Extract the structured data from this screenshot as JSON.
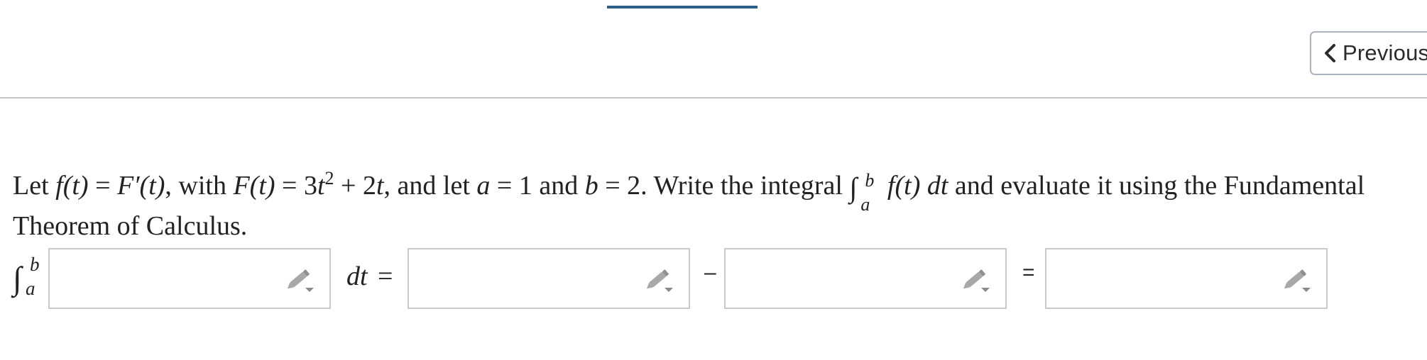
{
  "top_indicator": {
    "color": "#2e5f86"
  },
  "navigation": {
    "previous_label": "Previous",
    "previous_icon": "chevron-left-icon"
  },
  "question": {
    "text_1": "Let ",
    "f_t": "f(t)",
    "eq": " = ",
    "Fprime_t": "F′(t)",
    "text_2": ", with ",
    "F_t": "F(t)",
    "eq2": " = 3",
    "t_var": "t",
    "power": "2",
    "rest_expr": " + 2",
    "t_var2": "t",
    "text_3": ", and let ",
    "a_var": "a",
    "eq3": " = 1 and ",
    "b_var": "b",
    "eq4": " = 2. Write the integral ",
    "int_sign": "∫",
    "int_upper": "b",
    "int_lower": "a",
    "integrand": " f(t) ",
    "dt": "dt",
    "text_4": " and evaluate it using the Fundamental Theorem of Calculus."
  },
  "answer_row": {
    "int_sign": "∫",
    "int_upper": "b",
    "int_lower": "a",
    "dt_label": "dt",
    "equals_1": "=",
    "minus": "–",
    "equals_2": "=",
    "box_icon": "pencil-icon"
  }
}
